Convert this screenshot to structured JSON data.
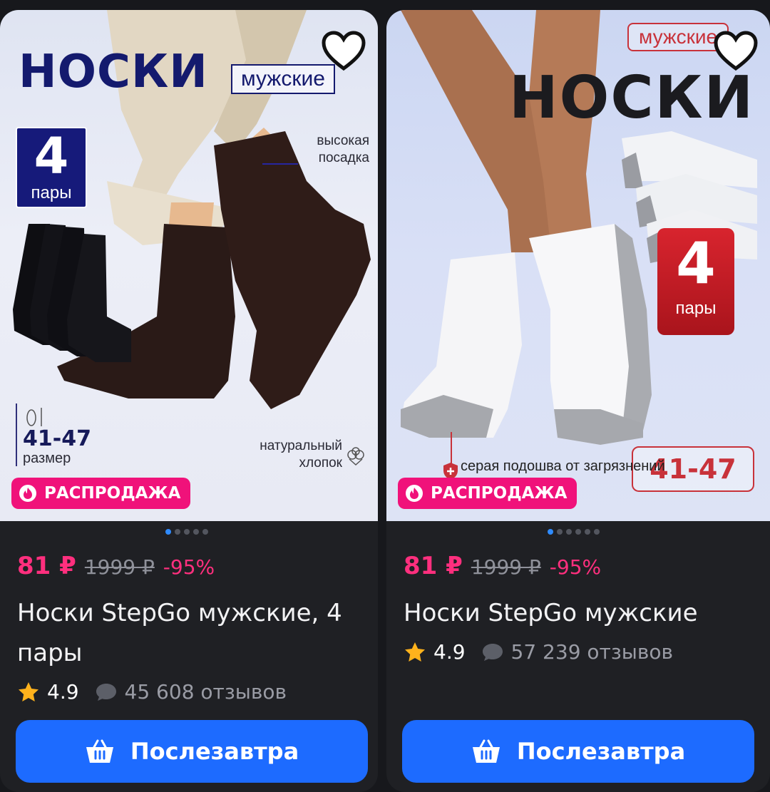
{
  "accent_color": "#1d6bff",
  "sale_color": "#f0127a",
  "products": [
    {
      "photo": {
        "title": "НОСКИ",
        "subtitle": "мужские",
        "pairs_number": "4",
        "pairs_word": "пары",
        "feature_1": "высокая посадка",
        "size_number": "41-47",
        "size_word": "размер",
        "feature_2": "натуральный хлопок"
      },
      "sale_badge": "РАСПРОДАЖА",
      "price_now": "81 ₽",
      "price_old": "1999 ₽",
      "discount": "-95%",
      "title": "Носки StepGo мужские, 4 пары",
      "rating": "4.9",
      "reviews": "45 608 отзывов",
      "cta": "Послезавтра",
      "slides_count": 5,
      "active_slide": 0
    },
    {
      "photo": {
        "title": "НОСКИ",
        "subtitle": "мужские",
        "pairs_number": "4",
        "pairs_word": "пары",
        "size_number": "41-47",
        "feature_1": "серая подошва от загрязнений"
      },
      "sale_badge": "РАСПРОДАЖА",
      "price_now": "81 ₽",
      "price_old": "1999 ₽",
      "discount": "-95%",
      "title": "Носки StepGo мужские",
      "rating": "4.9",
      "reviews": "57 239 отзывов",
      "cta": "Послезавтра",
      "slides_count": 6,
      "active_slide": 0
    }
  ]
}
